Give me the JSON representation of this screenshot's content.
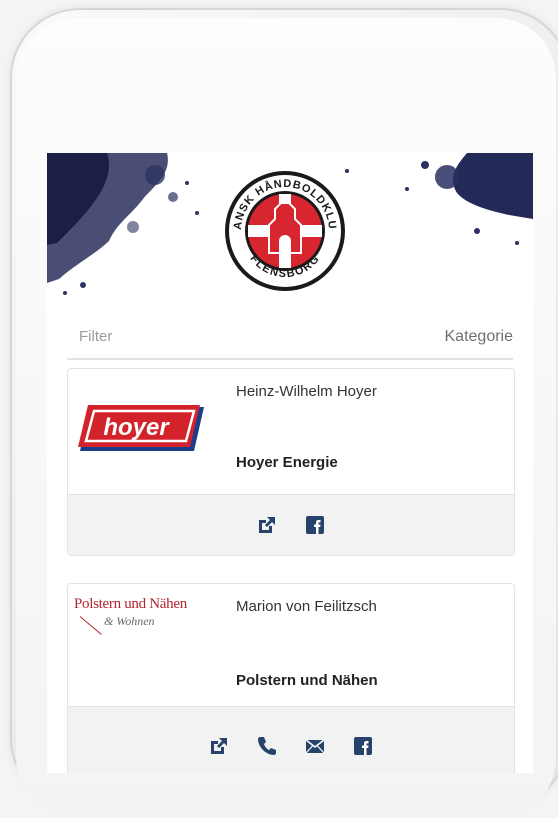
{
  "header": {
    "club_logo_top_text": "DANSK HÅNDBOLDKLUB",
    "club_logo_bottom_text": "FLENSBORG"
  },
  "filter": {
    "filter_label": "Filter",
    "category_label": "Kategorie"
  },
  "sponsors": [
    {
      "person": "Heinz-Wilhelm Hoyer",
      "company": "Hoyer Energie",
      "logo_text": "hoyer",
      "actions": [
        "external-link",
        "facebook"
      ]
    },
    {
      "person": "Marion von Feilitzsch",
      "company": "Polstern und Nähen",
      "logo_text": "Polstern und Nähen",
      "logo_subtext": "& Wohnen",
      "actions": [
        "external-link",
        "phone",
        "email",
        "facebook"
      ]
    }
  ],
  "colors": {
    "accent_icon": "#27436b",
    "hoyer_red": "#d2232a",
    "club_red": "#d7262f"
  }
}
